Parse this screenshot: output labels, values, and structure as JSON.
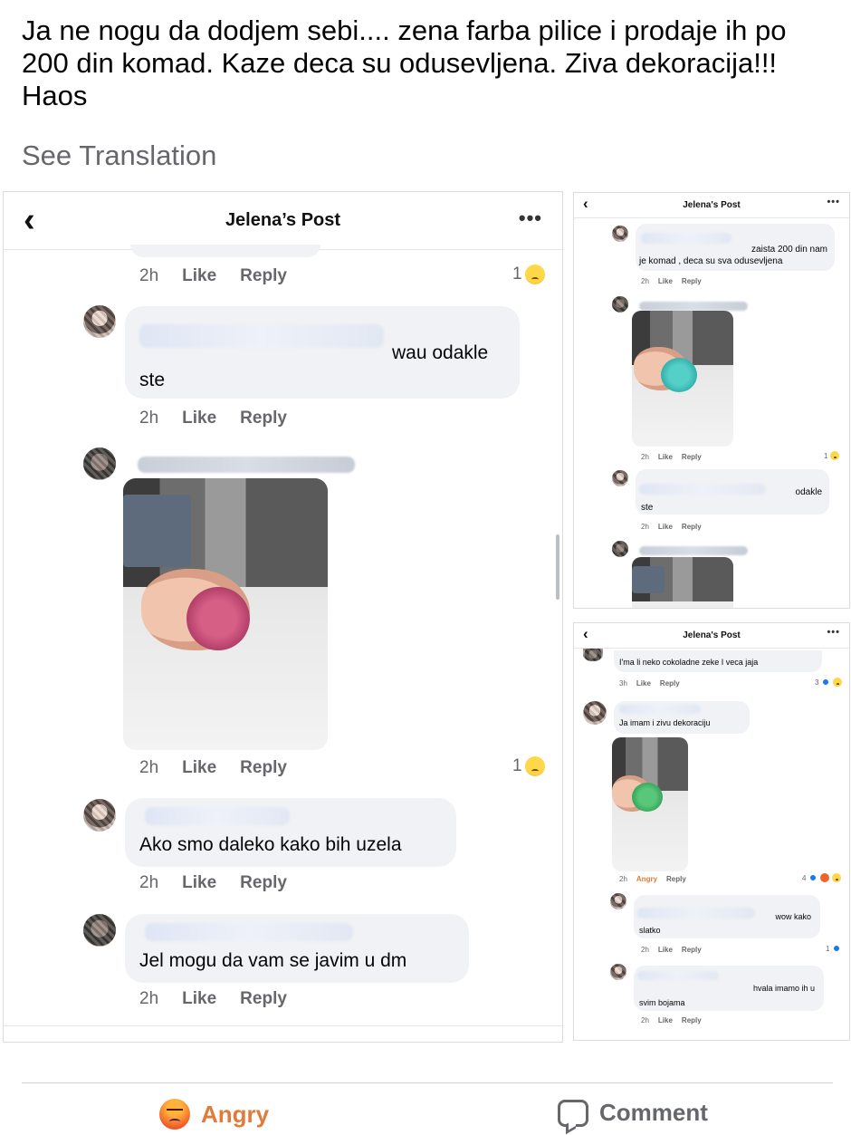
{
  "post": {
    "text": "Ja ne nogu da dodjem sebi.... zena farba pilice i prodaje ih po 200 din komad. Kaze deca su odusevljena. Ziva dekoracija!!! Haos",
    "see_translation": "See Translation"
  },
  "main_shot": {
    "header": {
      "back": "‹",
      "title": "Jelena’s Post",
      "more": "•••"
    },
    "comments": [
      {
        "time": "2h",
        "like": "Like",
        "reply": "Reply",
        "reactions": "1"
      },
      {
        "text_line1": "wau odakle",
        "text_line2": "ste",
        "time": "2h",
        "like": "Like",
        "reply": "Reply"
      },
      {
        "time": "2h",
        "like": "Like",
        "reply": "Reply",
        "reactions": "1"
      },
      {
        "text": "Ako smo daleko kako bih uzela",
        "time": "2h",
        "like": "Like",
        "reply": "Reply"
      },
      {
        "text": "Jel mogu da vam se javim u  dm",
        "time": "2h",
        "like": "Like",
        "reply": "Reply"
      }
    ]
  },
  "top_right_shot": {
    "header": {
      "back": "‹",
      "title": "Jelena's Post",
      "more": "•••"
    },
    "comments": [
      {
        "text_line1": "zaista 200 din nam",
        "text_line2": "je komad , deca su sva odusevljena",
        "time": "2h",
        "like": "Like",
        "reply": "Reply"
      },
      {
        "time": "2h",
        "like": "Like",
        "reply": "Reply",
        "reactions": "1"
      },
      {
        "text_line1": "odakle",
        "text_line2": "ste",
        "time": "2h",
        "like": "Like",
        "reply": "Reply"
      }
    ]
  },
  "bottom_right_shot": {
    "header": {
      "back": "‹",
      "title": "Jelena's Post",
      "more": "•••"
    },
    "comments": [
      {
        "text": "I'ma li neko cokoladne zeke I veca jaja",
        "time": "3h",
        "like": "Like",
        "reply": "Reply",
        "reactions": "3"
      },
      {
        "text": "Ja imam i zivu dekoraciju",
        "time": "2h",
        "like": "Angry",
        "reply": "Reply",
        "reactions": "4"
      },
      {
        "text_line1": "wow kako",
        "text_line2": "slatko",
        "time": "2h",
        "like": "Like",
        "reply": "Reply",
        "reactions": "1"
      },
      {
        "text_line1": "hvala imamo ih u",
        "text_line2": "svim bojama",
        "time": "2h",
        "like": "Like",
        "reply": "Reply"
      }
    ]
  },
  "actions": {
    "angry": "Angry",
    "comment": "Comment"
  },
  "colors": {
    "angry": "#e07b39",
    "meta": "#65676b",
    "bubble": "#f0f2f5"
  }
}
